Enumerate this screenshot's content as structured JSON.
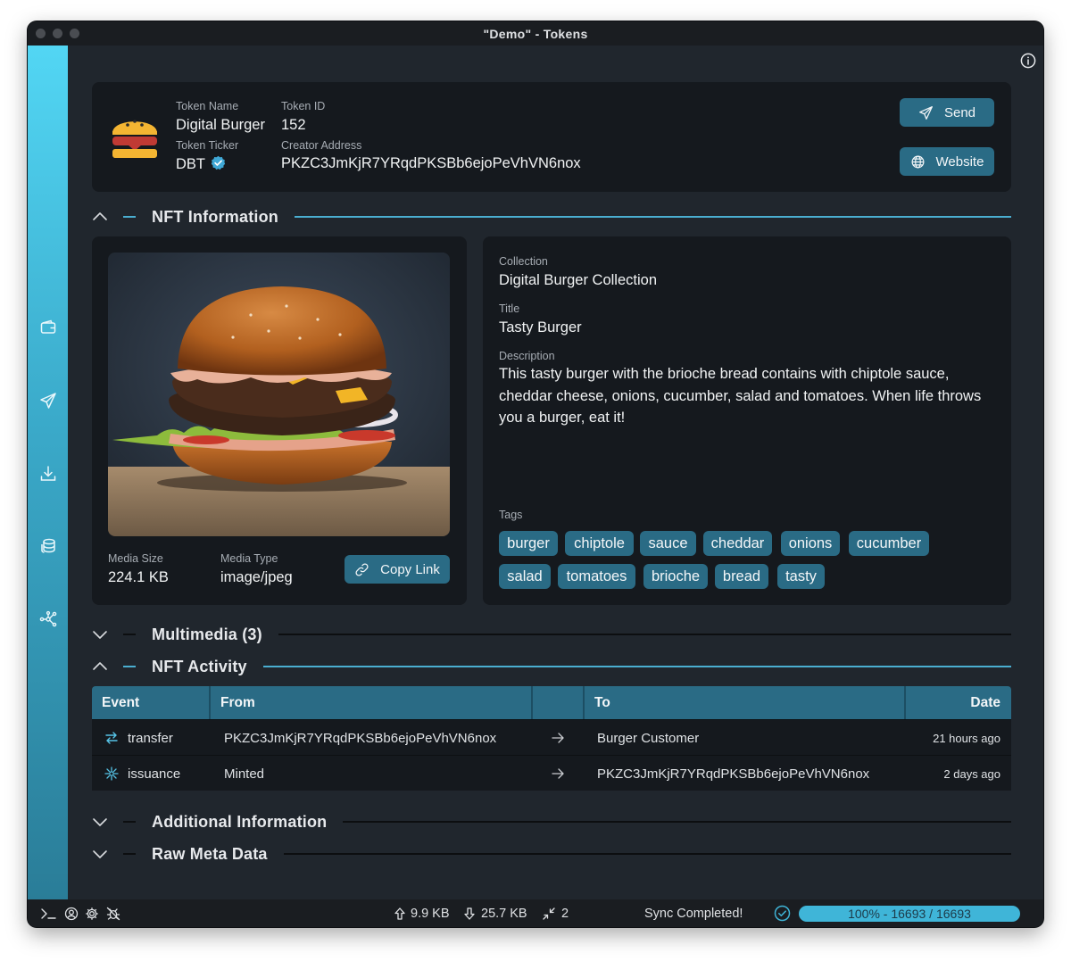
{
  "window": {
    "title": "\"Demo\" - Tokens"
  },
  "sidebar": {
    "items": [
      {
        "icon": "wallet-icon"
      },
      {
        "icon": "send-icon"
      },
      {
        "icon": "receive-icon"
      },
      {
        "icon": "tokens-icon"
      },
      {
        "icon": "network-icon"
      }
    ]
  },
  "header": {
    "token_name_label": "Token Name",
    "token_name": "Digital Burger",
    "token_id_label": "Token ID",
    "token_id": "152",
    "token_ticker_label": "Token Ticker",
    "token_ticker": "DBT",
    "creator_address_label": "Creator Address",
    "creator_address": "PKZC3JmKjR7YRqdPKSBb6ejoPeVhVN6nox",
    "send_label": "Send",
    "website_label": "Website"
  },
  "sections": {
    "nft_information": "NFT Information",
    "multimedia": "Multimedia (3)",
    "nft_activity": "NFT Activity",
    "additional_information": "Additional Information",
    "raw_meta_data": "Raw Meta Data"
  },
  "media": {
    "size_label": "Media Size",
    "size": "224.1 KB",
    "type_label": "Media Type",
    "type": "image/jpeg",
    "copy_link_label": "Copy Link"
  },
  "details": {
    "collection_label": "Collection",
    "collection": "Digital Burger Collection",
    "title_label": "Title",
    "title": "Tasty Burger",
    "description_label": "Description",
    "description": "This tasty burger with the brioche bread contains with chiptole sauce, cheddar cheese, onions, cucumber, salad and tomatoes. When life throws you a burger, eat it!",
    "tags_label": "Tags",
    "tags": [
      "burger",
      "chiptole",
      "sauce",
      "cheddar",
      "onions",
      "cucumber",
      "salad",
      "tomatoes",
      "brioche",
      "bread",
      "tasty"
    ]
  },
  "activity": {
    "columns": {
      "event": "Event",
      "from": "From",
      "to": "To",
      "date": "Date"
    },
    "rows": [
      {
        "event": "transfer",
        "icon": "transfer-icon",
        "from": "PKZC3JmKjR7YRqdPKSBb6ejoPeVhVN6nox",
        "to": "Burger Customer",
        "date": "21 hours ago"
      },
      {
        "event": "issuance",
        "icon": "issuance-icon",
        "from": "Minted",
        "to": "PKZC3JmKjR7YRqdPKSBb6ejoPeVhVN6nox",
        "date": "2 days ago"
      }
    ]
  },
  "statusbar": {
    "upload": "9.9 KB",
    "download": "25.7 KB",
    "peers": "2",
    "sync_status": "Sync Completed!",
    "progress_text": "100% - 16693 / 16693",
    "progress_fraction": 1.0
  },
  "colors": {
    "accent": "#2a6b85",
    "accent_line": "#4aaed0",
    "background": "#20262d",
    "card": "#15191e"
  }
}
